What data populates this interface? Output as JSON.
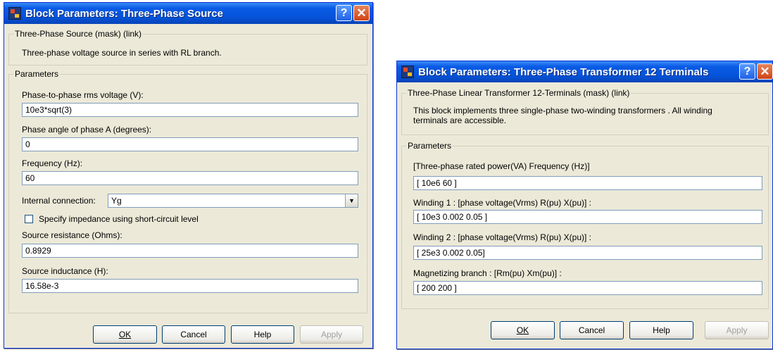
{
  "dialog1": {
    "title": "Block Parameters: Three-Phase Source",
    "help_glyph": "?",
    "close_glyph": "✕",
    "mask_group": {
      "legend": "Three-Phase Source (mask) (link)",
      "description": "Three-phase voltage source in series with RL branch."
    },
    "params_group": {
      "legend": "Parameters",
      "fields": [
        {
          "label": "Phase-to-phase rms voltage (V):",
          "value": "10e3*sqrt(3)"
        },
        {
          "label": "Phase angle of phase A (degrees):",
          "value": "0"
        },
        {
          "label": "Frequency (Hz):",
          "value": "60"
        }
      ],
      "connection": {
        "label": "Internal connection:",
        "value": "Yg"
      },
      "checkbox": {
        "label": "Specify impedance using short-circuit level",
        "checked": false
      },
      "fields2": [
        {
          "label": "Source resistance (Ohms):",
          "value": "0.8929"
        },
        {
          "label": "Source inductance (H):",
          "value": "16.58e-3"
        }
      ]
    },
    "buttons": {
      "ok": "OK",
      "cancel": "Cancel",
      "help": "Help",
      "apply": "Apply"
    }
  },
  "dialog2": {
    "title": "Block Parameters: Three-Phase Transformer 12 Terminals",
    "help_glyph": "?",
    "close_glyph": "✕",
    "mask_group": {
      "legend": "Three-Phase Linear Transformer 12-Terminals (mask) (link)",
      "description": "This block implements three single-phase two-winding transformers . All winding terminals are accessible."
    },
    "params_group": {
      "legend": "Parameters",
      "fields": [
        {
          "label": "[Three-phase rated power(VA)  Frequency (Hz)]",
          "value": "[ 10e6 60 ]"
        },
        {
          "label": "Winding 1 : [phase voltage(Vrms)  R(pu)  X(pu)] :",
          "value": "[ 10e3 0.002  0.05 ]"
        },
        {
          "label": "Winding 2 : [phase voltage(Vrms)  R(pu)  X(pu)] :",
          "value": "[ 25e3 0.002 0.05]"
        },
        {
          "label": "Magnetizing branch : [Rm(pu)  Xm(pu)] :",
          "value": "[ 200 200 ]"
        }
      ]
    },
    "buttons": {
      "ok": "OK",
      "cancel": "Cancel",
      "help": "Help",
      "apply": "Apply"
    }
  }
}
